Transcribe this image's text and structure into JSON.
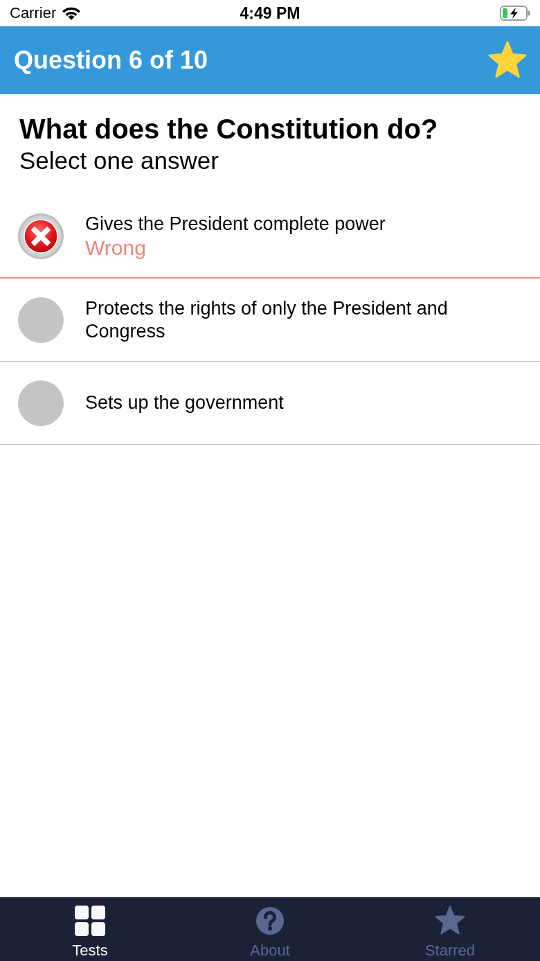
{
  "status_bar": {
    "carrier": "Carrier",
    "time": "4:49 PM",
    "battery": {
      "charging": true
    }
  },
  "header": {
    "title": "Question 6 of 10",
    "starred": true
  },
  "question": {
    "title": "What does the Constitution do?",
    "instruction": "Select one answer"
  },
  "answers": [
    {
      "text": "Gives the President complete power",
      "selected": true,
      "correct": false,
      "feedback": "Wrong"
    },
    {
      "text": "Protects the rights of only the President and Congress",
      "selected": false
    },
    {
      "text": "Sets up the government",
      "selected": false
    }
  ],
  "tabs": [
    {
      "label": "Tests",
      "selected": true
    },
    {
      "label": "About",
      "selected": false
    },
    {
      "label": "Starred",
      "selected": false
    }
  ]
}
